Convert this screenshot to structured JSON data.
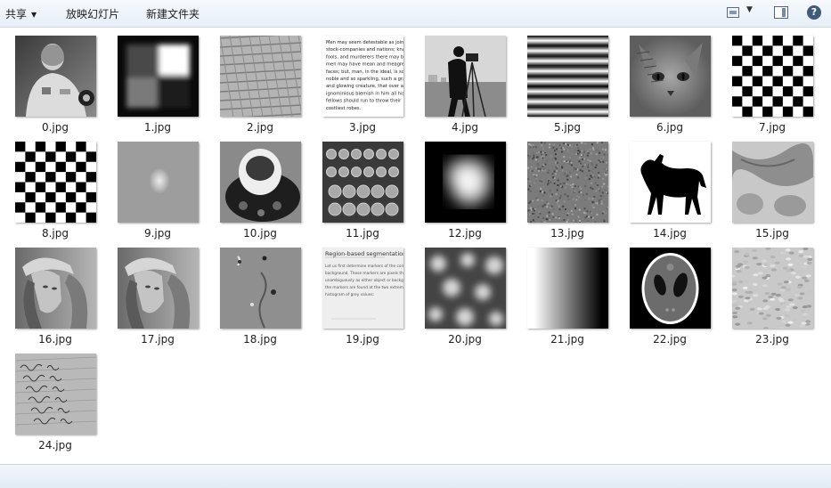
{
  "toolbar": {
    "share_label": "共享",
    "slideshow_label": "放映幻灯片",
    "new_folder_label": "新建文件夹",
    "view_icon": "view-options-icon",
    "pane_icon": "preview-pane-icon",
    "help_icon": "help-icon"
  },
  "files": [
    {
      "name": "0.jpg",
      "thumb": "astronaut"
    },
    {
      "name": "1.jpg",
      "thumb": "squares"
    },
    {
      "name": "2.jpg",
      "thumb": "brick-texture"
    },
    {
      "name": "3.jpg",
      "thumb": "text"
    },
    {
      "name": "4.jpg",
      "thumb": "cameraman"
    },
    {
      "name": "5.jpg",
      "thumb": "stripes"
    },
    {
      "name": "6.jpg",
      "thumb": "cat"
    },
    {
      "name": "7.jpg",
      "thumb": "checkerboard"
    },
    {
      "name": "8.jpg",
      "thumb": "checkerboard"
    },
    {
      "name": "9.jpg",
      "thumb": "blob"
    },
    {
      "name": "10.jpg",
      "thumb": "coffee"
    },
    {
      "name": "11.jpg",
      "thumb": "coins"
    },
    {
      "name": "12.jpg",
      "thumb": "glow"
    },
    {
      "name": "13.jpg",
      "thumb": "noise"
    },
    {
      "name": "14.jpg",
      "thumb": "horse"
    },
    {
      "name": "15.jpg",
      "thumb": "cells"
    },
    {
      "name": "16.jpg",
      "thumb": "lena"
    },
    {
      "name": "17.jpg",
      "thumb": "lena"
    },
    {
      "name": "18.jpg",
      "thumb": "surface"
    },
    {
      "name": "19.jpg",
      "thumb": "document"
    },
    {
      "name": "20.jpg",
      "thumb": "blobs"
    },
    {
      "name": "21.jpg",
      "thumb": "gradient"
    },
    {
      "name": "22.jpg",
      "thumb": "phantom"
    },
    {
      "name": "23.jpg",
      "thumb": "paper-texture"
    },
    {
      "name": "24.jpg",
      "thumb": "handwriting"
    }
  ],
  "document_thumb": {
    "heading": "Region-based segmentation",
    "lines": [
      "Let us first determine markers of the coins and the",
      "background. These markers are pixels that we can label",
      "unambiguously as either object or background. Here,",
      "the markers are found at the two extreme parts of the",
      "histogram of grey values:"
    ]
  },
  "text_thumb": {
    "lines": [
      "Men may seem detestable as joint",
      "stock-companies and nations; knaves,",
      "fools, and murderers there may be;",
      "men may have mean and meagre",
      "faces; but, man, in the ideal, is so",
      "noble and so sparkling, such a grand",
      "and glowing creature, that over any",
      "ignominious blemish in him all his",
      "fellows should run to throw their",
      "costliest robes."
    ]
  }
}
